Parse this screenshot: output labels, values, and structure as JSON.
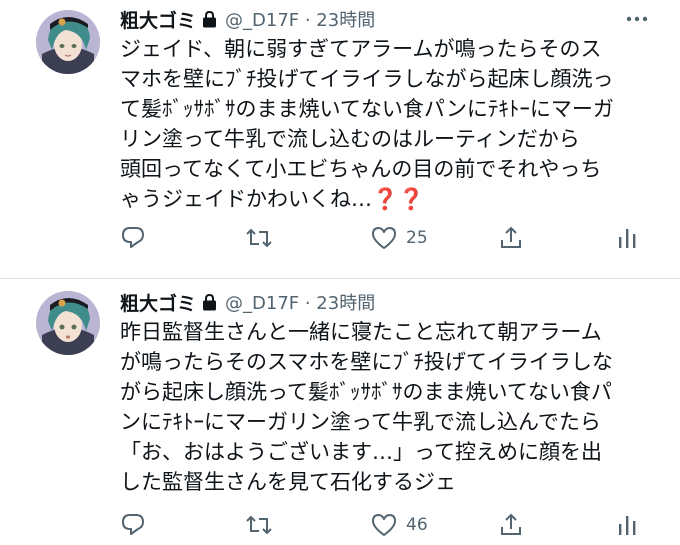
{
  "tweets": [
    {
      "display_name": "粗大ゴミ",
      "handle_time": "@_D17F · 23時間",
      "lines": [
        "ジェイド、朝に弱すぎてアラームが鳴ったらそのス",
        "マホを壁にﾌﾞﾁ投げてイライラしながら起床し顔洗っ",
        "て髪ﾎﾞｯｻﾎﾞｻのまま焼いてない食パンにﾃｷﾄｰにマーガ",
        "リン塗って牛乳で流し込むのはルーティンだから",
        "頭回ってなくて小エビちゃんの目の前でそれやっち",
        "ゃうジェイドかわいくね…❓❓"
      ],
      "reply_count": "",
      "retweet_count": "",
      "like_count": "25"
    },
    {
      "display_name": "粗大ゴミ",
      "handle_time": "@_D17F · 23時間",
      "lines": [
        "昨日監督生さんと一緒に寝たこと忘れて朝アラーム",
        "が鳴ったらそのスマホを壁にﾌﾞﾁ投げてイライラしな",
        "がら起床し顔洗って髪ﾎﾞｯｻﾎﾞｻのまま焼いてない食パ",
        "ンにﾃｷﾄｰにマーガリン塗って牛乳で流し込んでたら",
        "「お、おはようございます…」って控えめに顔を出",
        "した監督生さんを見て石化するジェ"
      ],
      "reply_count": "",
      "retweet_count": "",
      "like_count": "46"
    }
  ],
  "colors": {
    "text": "#0f1419",
    "secondary": "#536471",
    "divider": "#e1e6ea",
    "question_mark": "#e0245e"
  }
}
